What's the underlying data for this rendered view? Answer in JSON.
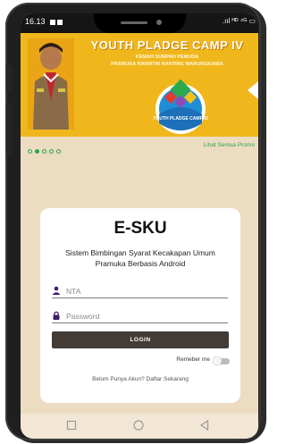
{
  "status_bar": {
    "time": "16.13",
    "right_text": ".ııl ᴴᴰ ⁴ᴳ ▭"
  },
  "banner": {
    "title": "YOUTH PLADGE CAMP IV",
    "subtitle_1": "KEMAH SUMPAH PEMUDA",
    "subtitle_2": "PRAMUKA KWARTIR RANTING WARUNGKIARA",
    "logo_text": "YOUTH PLADGE CAMP IV",
    "colors": {
      "background": "#f0b71d",
      "accent": "#2ca84d"
    }
  },
  "carousel": {
    "dot_count": 5,
    "active_index": 1,
    "promo_link": "Lihat Semua Promo"
  },
  "login": {
    "app_title": "E-SKU",
    "description": "Sistem Bimbingan Syarat Kecakapan Umum Pramuka Berbasis Android",
    "nta_placeholder": "NTA",
    "password_placeholder": "Password",
    "login_button": "LOGIN",
    "remember_label": "Remeber me",
    "remember_checked": false,
    "register_text": "Belum Punya Akun? Daftar Sekarang",
    "colors": {
      "button": "#433b35",
      "icon": "#3d1d6b"
    }
  },
  "nav": {
    "icons": [
      "square-icon",
      "circle-icon",
      "triangle-back-icon"
    ]
  }
}
